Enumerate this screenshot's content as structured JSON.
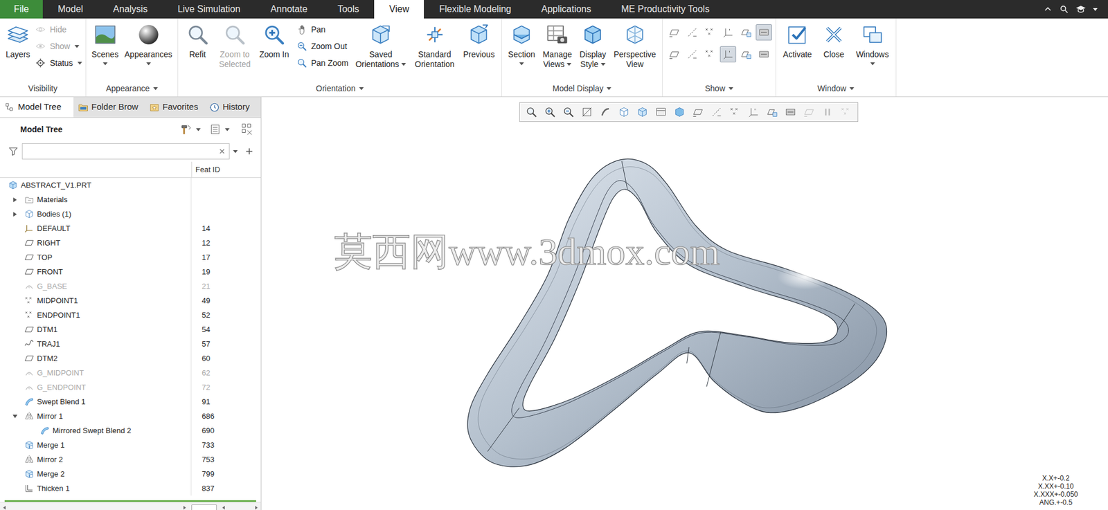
{
  "menu_bar": {
    "tabs": [
      {
        "label": "File",
        "selected": false
      },
      {
        "label": "Model",
        "selected": false
      },
      {
        "label": "Analysis",
        "selected": false
      },
      {
        "label": "Live Simulation",
        "selected": false
      },
      {
        "label": "Annotate",
        "selected": false
      },
      {
        "label": "Tools",
        "selected": false
      },
      {
        "label": "View",
        "selected": true
      },
      {
        "label": "Flexible Modeling",
        "selected": false
      },
      {
        "label": "Applications",
        "selected": false
      },
      {
        "label": "ME Productivity Tools",
        "selected": false
      }
    ]
  },
  "ribbon": {
    "groups": [
      {
        "label": "Visibility",
        "dropdown": false,
        "items": [
          {
            "kind": "large",
            "lines": [
              "Layers"
            ],
            "dropdown": false,
            "disabled": false
          },
          {
            "kind": "stack",
            "items": [
              {
                "label": "Hide",
                "dropdown": false,
                "disabled": true
              },
              {
                "label": "Show",
                "dropdown": true,
                "disabled": true
              },
              {
                "label": "Status",
                "dropdown": true,
                "disabled": false
              }
            ]
          }
        ]
      },
      {
        "label": "Appearance",
        "dropdown": true,
        "items": [
          {
            "kind": "large",
            "lines": [
              "Scenes"
            ],
            "dropdown": true,
            "disabled": false
          },
          {
            "kind": "large",
            "lines": [
              "Appearances"
            ],
            "dropdown": true,
            "disabled": false
          }
        ]
      },
      {
        "label": "Orientation",
        "dropdown": true,
        "items": [
          {
            "kind": "large",
            "lines": [
              "Refit"
            ],
            "dropdown": false,
            "disabled": false
          },
          {
            "kind": "large",
            "lines": [
              "Zoom to",
              "Selected"
            ],
            "dropdown": false,
            "disabled": true
          },
          {
            "kind": "large",
            "lines": [
              "Zoom In"
            ],
            "dropdown": false,
            "disabled": false
          },
          {
            "kind": "stack",
            "items": [
              {
                "label": "Pan",
                "dropdown": false,
                "disabled": false
              },
              {
                "label": "Zoom Out",
                "dropdown": false,
                "disabled": false
              },
              {
                "label": "Pan Zoom",
                "dropdown": false,
                "disabled": false
              }
            ]
          },
          {
            "kind": "large",
            "lines": [
              "Saved",
              "Orientations"
            ],
            "dropdown": true,
            "disabled": false
          },
          {
            "kind": "large",
            "lines": [
              "Standard",
              "Orientation"
            ],
            "dropdown": false,
            "disabled": false
          },
          {
            "kind": "large",
            "lines": [
              "Previous"
            ],
            "dropdown": false,
            "disabled": false
          }
        ]
      },
      {
        "label": "Model Display",
        "dropdown": true,
        "items": [
          {
            "kind": "large",
            "lines": [
              "Section"
            ],
            "dropdown": true,
            "disabled": false
          },
          {
            "kind": "large",
            "lines": [
              "Manage",
              "Views"
            ],
            "dropdown": true,
            "disabled": false
          },
          {
            "kind": "large",
            "lines": [
              "Display",
              "Style"
            ],
            "dropdown": true,
            "disabled": false
          },
          {
            "kind": "large",
            "lines": [
              "Perspective",
              "View"
            ],
            "dropdown": false,
            "disabled": false
          }
        ]
      },
      {
        "label": "Show",
        "dropdown": true,
        "items": [
          {
            "kind": "icon_grid",
            "icons": [
              {
                "selected": false
              },
              {
                "selected": false
              },
              {
                "selected": false
              },
              {
                "selected": false
              },
              {
                "selected": false
              },
              {
                "selected": true
              },
              {
                "selected": false
              },
              {
                "selected": false
              },
              {
                "selected": false
              },
              {
                "selected": true
              },
              {
                "selected": false
              },
              {
                "selected": false
              }
            ]
          }
        ]
      },
      {
        "label": "Window",
        "dropdown": true,
        "items": [
          {
            "kind": "large",
            "lines": [
              "Activate"
            ],
            "dropdown": false,
            "disabled": false
          },
          {
            "kind": "large",
            "lines": [
              "Close"
            ],
            "dropdown": false,
            "disabled": false
          },
          {
            "kind": "large",
            "lines": [
              "Windows"
            ],
            "dropdown": true,
            "disabled": false
          }
        ]
      }
    ]
  },
  "model_tree": {
    "tabs": [
      {
        "label": "Model Tree",
        "selected": true
      },
      {
        "label": "Folder Brow",
        "selected": false
      },
      {
        "label": "Favorites",
        "selected": false
      },
      {
        "label": "History",
        "selected": false
      }
    ],
    "title": "Model Tree",
    "filter": {
      "value": ""
    },
    "feat_id_column": "Feat ID",
    "rows": [
      {
        "label": "ABSTRACT_V1.PRT",
        "feat_id": "",
        "indent": 0,
        "kind": "part",
        "suppressed": false
      },
      {
        "label": "Materials",
        "feat_id": "",
        "indent": 1,
        "kind": "materials",
        "suppressed": false,
        "expanded": false
      },
      {
        "label": "Bodies (1)",
        "feat_id": "",
        "indent": 1,
        "kind": "bodies",
        "suppressed": false,
        "expanded": false
      },
      {
        "label": "DEFAULT",
        "feat_id": "14",
        "indent": 1,
        "kind": "csys",
        "suppressed": false
      },
      {
        "label": "RIGHT",
        "feat_id": "12",
        "indent": 1,
        "kind": "plane",
        "suppressed": false
      },
      {
        "label": "TOP",
        "feat_id": "17",
        "indent": 1,
        "kind": "plane",
        "suppressed": false
      },
      {
        "label": "FRONT",
        "feat_id": "19",
        "indent": 1,
        "kind": "plane",
        "suppressed": false
      },
      {
        "label": "G_BASE",
        "feat_id": "21",
        "indent": 1,
        "kind": "group",
        "suppressed": true
      },
      {
        "label": "MIDPOINT1",
        "feat_id": "49",
        "indent": 1,
        "kind": "point",
        "suppressed": false
      },
      {
        "label": "ENDPOINT1",
        "feat_id": "52",
        "indent": 1,
        "kind": "point",
        "suppressed": false
      },
      {
        "label": "DTM1",
        "feat_id": "54",
        "indent": 1,
        "kind": "plane",
        "suppressed": false
      },
      {
        "label": "TRAJ1",
        "feat_id": "57",
        "indent": 1,
        "kind": "curve",
        "suppressed": false
      },
      {
        "label": "DTM2",
        "feat_id": "60",
        "indent": 1,
        "kind": "plane",
        "suppressed": false
      },
      {
        "label": "G_MIDPOINT",
        "feat_id": "62",
        "indent": 1,
        "kind": "group",
        "suppressed": true
      },
      {
        "label": "G_ENDPOINT",
        "feat_id": "72",
        "indent": 1,
        "kind": "group",
        "suppressed": true
      },
      {
        "label": "Swept Blend 1",
        "feat_id": "91",
        "indent": 1,
        "kind": "sweep",
        "suppressed": false
      },
      {
        "label": "Mirror 1",
        "feat_id": "686",
        "indent": 1,
        "kind": "mirror",
        "suppressed": false,
        "expanded": true
      },
      {
        "label": "Mirrored Swept Blend 2",
        "feat_id": "690",
        "indent": 2,
        "kind": "sweep",
        "suppressed": false
      },
      {
        "label": "Merge 1",
        "feat_id": "733",
        "indent": 1,
        "kind": "merge",
        "suppressed": false
      },
      {
        "label": "Mirror 2",
        "feat_id": "753",
        "indent": 1,
        "kind": "mirror",
        "suppressed": false
      },
      {
        "label": "Merge 2",
        "feat_id": "799",
        "indent": 1,
        "kind": "merge",
        "suppressed": false
      },
      {
        "label": "Thicken 1",
        "feat_id": "837",
        "indent": 1,
        "kind": "thicken",
        "suppressed": false
      }
    ]
  },
  "graphics": {
    "view_toolbar": [
      {
        "disabled": false
      },
      {
        "disabled": false
      },
      {
        "disabled": false
      },
      {
        "disabled": false
      },
      {
        "disabled": false
      },
      {
        "disabled": false
      },
      {
        "disabled": false
      },
      {
        "disabled": false
      },
      {
        "disabled": false
      },
      {
        "disabled": false
      },
      {
        "disabled": false
      },
      {
        "disabled": false
      },
      {
        "disabled": false
      },
      {
        "disabled": false
      },
      {
        "disabled": false
      },
      {
        "disabled": true
      },
      {
        "disabled": true
      },
      {
        "disabled": true
      }
    ],
    "watermark": "莫西网www.3dmox.com",
    "tolerances": [
      "X.X+-0.2",
      "X.XX+-0.10",
      "X.XXX+-0.050",
      "ANG.+-0.5"
    ]
  }
}
